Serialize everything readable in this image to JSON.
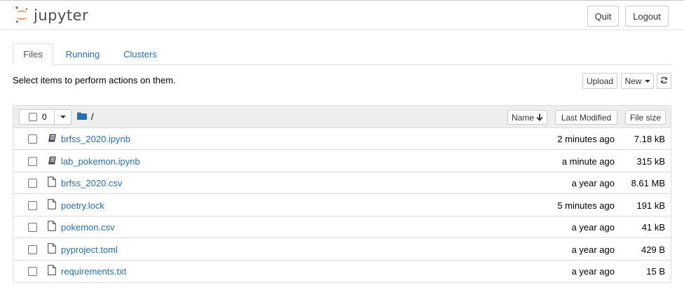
{
  "header": {
    "logo_text": "jupyter",
    "quit_label": "Quit",
    "logout_label": "Logout"
  },
  "tabs": [
    {
      "label": "Files",
      "active": true
    },
    {
      "label": "Running",
      "active": false
    },
    {
      "label": "Clusters",
      "active": false
    }
  ],
  "toolbar": {
    "hint": "Select items to perform actions on them.",
    "upload_label": "Upload",
    "new_label": "New"
  },
  "list": {
    "selected_count": "0",
    "path": "/",
    "columns": {
      "name": "Name",
      "last_modified": "Last Modified",
      "file_size": "File size"
    },
    "rows": [
      {
        "name": "brfss_2020.ipynb",
        "icon": "notebook-icon",
        "modified": "2 minutes ago",
        "size": "7.18 kB"
      },
      {
        "name": "lab_pokemon.ipynb",
        "icon": "notebook-icon",
        "modified": "a minute ago",
        "size": "315 kB"
      },
      {
        "name": "brfss_2020.csv",
        "icon": "file-icon",
        "modified": "a year ago",
        "size": "8.61 MB"
      },
      {
        "name": "poetry.lock",
        "icon": "file-icon",
        "modified": "5 minutes ago",
        "size": "191 kB"
      },
      {
        "name": "pokemon.csv",
        "icon": "file-icon",
        "modified": "a year ago",
        "size": "41 kB"
      },
      {
        "name": "pyproject.toml",
        "icon": "file-icon",
        "modified": "a year ago",
        "size": "429 B"
      },
      {
        "name": "requirements.txt",
        "icon": "file-icon",
        "modified": "a year ago",
        "size": "15 B"
      }
    ]
  },
  "colors": {
    "link": "#296eaa",
    "logo_orange": "#f37726",
    "folder_blue": "#296eaa"
  }
}
